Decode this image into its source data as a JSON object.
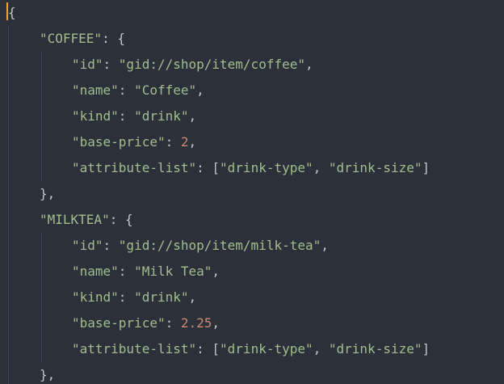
{
  "lines": [
    {
      "indent": 0,
      "tokens": [
        {
          "t": "punc",
          "v": "{"
        }
      ]
    },
    {
      "indent": 1,
      "tokens": [
        {
          "t": "key",
          "v": "\"COFFEE\""
        },
        {
          "t": "punc",
          "v": ": {"
        }
      ]
    },
    {
      "indent": 2,
      "tokens": [
        {
          "t": "key",
          "v": "\"id\""
        },
        {
          "t": "punc",
          "v": ": "
        },
        {
          "t": "str",
          "v": "\"gid://shop/item/coffee\""
        },
        {
          "t": "punc",
          "v": ","
        }
      ]
    },
    {
      "indent": 2,
      "tokens": [
        {
          "t": "key",
          "v": "\"name\""
        },
        {
          "t": "punc",
          "v": ": "
        },
        {
          "t": "str",
          "v": "\"Coffee\""
        },
        {
          "t": "punc",
          "v": ","
        }
      ]
    },
    {
      "indent": 2,
      "tokens": [
        {
          "t": "key",
          "v": "\"kind\""
        },
        {
          "t": "punc",
          "v": ": "
        },
        {
          "t": "str",
          "v": "\"drink\""
        },
        {
          "t": "punc",
          "v": ","
        }
      ]
    },
    {
      "indent": 2,
      "tokens": [
        {
          "t": "key",
          "v": "\"base-price\""
        },
        {
          "t": "punc",
          "v": ": "
        },
        {
          "t": "num",
          "v": "2"
        },
        {
          "t": "punc",
          "v": ","
        }
      ]
    },
    {
      "indent": 2,
      "tokens": [
        {
          "t": "key",
          "v": "\"attribute-list\""
        },
        {
          "t": "punc",
          "v": ": ["
        },
        {
          "t": "str",
          "v": "\"drink-type\""
        },
        {
          "t": "punc",
          "v": ", "
        },
        {
          "t": "str",
          "v": "\"drink-size\""
        },
        {
          "t": "punc",
          "v": "]"
        }
      ]
    },
    {
      "indent": 1,
      "tokens": [
        {
          "t": "punc",
          "v": "},"
        }
      ]
    },
    {
      "indent": 1,
      "tokens": [
        {
          "t": "key",
          "v": "\"MILKTEA\""
        },
        {
          "t": "punc",
          "v": ": {"
        }
      ]
    },
    {
      "indent": 2,
      "tokens": [
        {
          "t": "key",
          "v": "\"id\""
        },
        {
          "t": "punc",
          "v": ": "
        },
        {
          "t": "str",
          "v": "\"gid://shop/item/milk-tea\""
        },
        {
          "t": "punc",
          "v": ","
        }
      ]
    },
    {
      "indent": 2,
      "tokens": [
        {
          "t": "key",
          "v": "\"name\""
        },
        {
          "t": "punc",
          "v": ": "
        },
        {
          "t": "str",
          "v": "\"Milk Tea\""
        },
        {
          "t": "punc",
          "v": ","
        }
      ]
    },
    {
      "indent": 2,
      "tokens": [
        {
          "t": "key",
          "v": "\"kind\""
        },
        {
          "t": "punc",
          "v": ": "
        },
        {
          "t": "str",
          "v": "\"drink\""
        },
        {
          "t": "punc",
          "v": ","
        }
      ]
    },
    {
      "indent": 2,
      "tokens": [
        {
          "t": "key",
          "v": "\"base-price\""
        },
        {
          "t": "punc",
          "v": ": "
        },
        {
          "t": "num",
          "v": "2.25"
        },
        {
          "t": "punc",
          "v": ","
        }
      ]
    },
    {
      "indent": 2,
      "tokens": [
        {
          "t": "key",
          "v": "\"attribute-list\""
        },
        {
          "t": "punc",
          "v": ": ["
        },
        {
          "t": "str",
          "v": "\"drink-type\""
        },
        {
          "t": "punc",
          "v": ", "
        },
        {
          "t": "str",
          "v": "\"drink-size\""
        },
        {
          "t": "punc",
          "v": "]"
        }
      ]
    },
    {
      "indent": 1,
      "tokens": [
        {
          "t": "punc",
          "v": "},"
        }
      ]
    }
  ],
  "colors": {
    "background": "#2b303b",
    "string": "#a3be8c",
    "number": "#d08770",
    "punctuation": "#c0c5ce",
    "cursor": "#e5a83b",
    "indent_guide": "#3f4552"
  }
}
